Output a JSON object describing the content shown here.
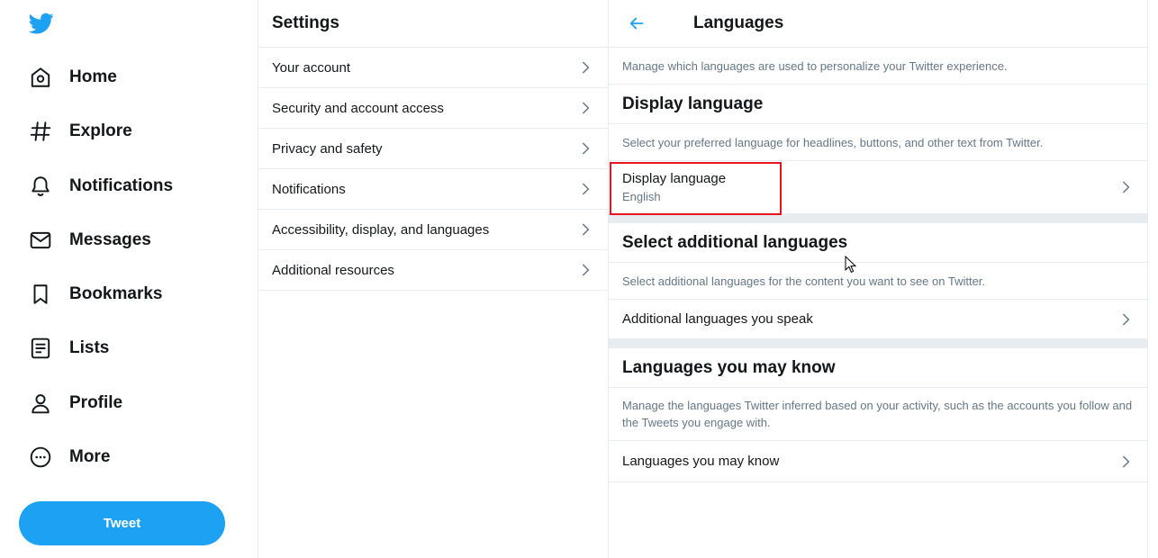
{
  "nav": {
    "logo_icon": "twitter-bird-icon",
    "items": [
      {
        "label": "Home",
        "icon": "home-icon"
      },
      {
        "label": "Explore",
        "icon": "hashtag-icon"
      },
      {
        "label": "Notifications",
        "icon": "bell-icon"
      },
      {
        "label": "Messages",
        "icon": "envelope-icon"
      },
      {
        "label": "Bookmarks",
        "icon": "bookmark-icon"
      },
      {
        "label": "Lists",
        "icon": "list-icon"
      },
      {
        "label": "Profile",
        "icon": "person-icon"
      },
      {
        "label": "More",
        "icon": "more-circle-icon"
      }
    ],
    "tweet_label": "Tweet"
  },
  "settings": {
    "title": "Settings",
    "items": [
      {
        "label": "Your account"
      },
      {
        "label": "Security and account access"
      },
      {
        "label": "Privacy and safety"
      },
      {
        "label": "Notifications"
      },
      {
        "label": "Accessibility, display, and languages"
      },
      {
        "label": "Additional resources"
      }
    ]
  },
  "languages": {
    "title": "Languages",
    "intro": "Manage which languages are used to personalize your Twitter experience.",
    "display": {
      "heading": "Display language",
      "description": "Select your preferred language for headlines, buttons, and other text from Twitter.",
      "row_label": "Display language",
      "row_value": "English"
    },
    "additional": {
      "heading": "Select additional languages",
      "description": "Select additional languages for the content you want to see on Twitter.",
      "row_label": "Additional languages you speak"
    },
    "may_know": {
      "heading": "Languages you may know",
      "description": "Manage the languages Twitter inferred based on your activity, such as the accounts you follow and the Tweets you engage with.",
      "row_label": "Languages you may know"
    }
  },
  "colors": {
    "accent": "#1da1f2",
    "highlight_box": "#e8141d",
    "border": "#e6ecf0",
    "muted_text": "#657786"
  }
}
